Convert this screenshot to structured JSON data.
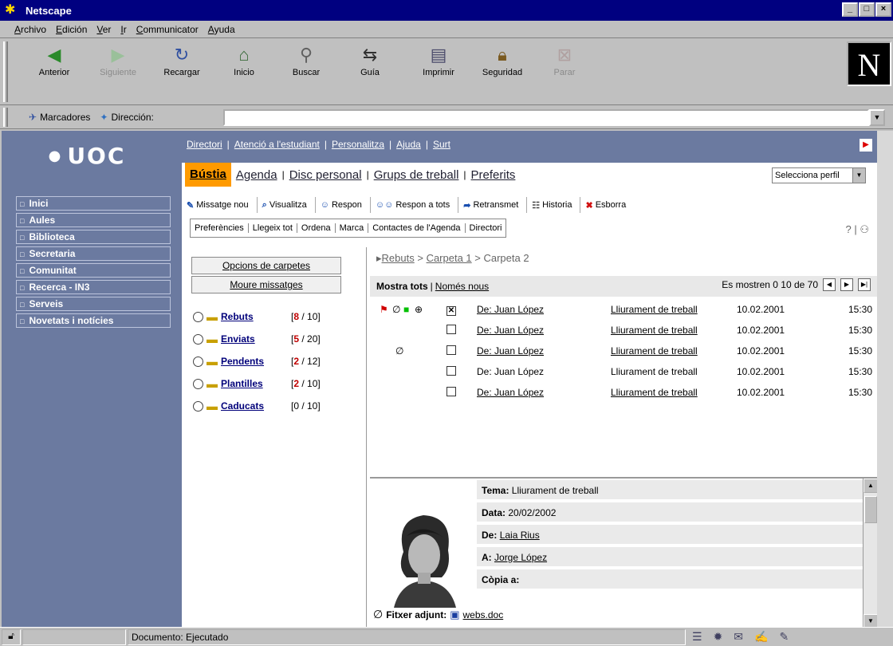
{
  "window": {
    "title": "Netscape"
  },
  "menu": [
    "Archivo",
    "Edición",
    "Ver",
    "Ir",
    "Communicator",
    "Ayuda"
  ],
  "toolbar": [
    {
      "label": "Anterior",
      "icon": "back-arrow-icon"
    },
    {
      "label": "Siguiente",
      "icon": "forward-arrow-icon",
      "disabled": true
    },
    {
      "label": "Recargar",
      "icon": "reload-icon"
    },
    {
      "label": "Inicio",
      "icon": "home-icon"
    },
    {
      "label": "Buscar",
      "icon": "search-icon"
    },
    {
      "label": "Guía",
      "icon": "guide-icon"
    },
    {
      "label": "Imprimir",
      "icon": "printer-icon"
    },
    {
      "label": "Seguridad",
      "icon": "lock-icon"
    },
    {
      "label": "Parar",
      "icon": "stop-icon",
      "disabled": true
    }
  ],
  "location": {
    "bookmarks": "Marcadores",
    "direccion": "Dirección:",
    "url": ""
  },
  "uoc": {
    "logo": "UOC",
    "toplinks": [
      "Directori",
      "Atenció a l'estudiant",
      "Personalitza",
      "Ajuda",
      "Surt"
    ],
    "tabs": {
      "active": "Bústia",
      "others": [
        "Agenda",
        "Disc personal",
        "Grups de treball",
        "Preferits"
      ]
    },
    "perfil": "Selecciona perfil"
  },
  "sidebar": [
    "Inici",
    "Aules",
    "Biblioteca",
    "Secretaria",
    "Comunitat",
    "Recerca - IN3",
    "Serveis",
    "Novetats i notícies"
  ],
  "actions": [
    "Missatge nou",
    "Visualitza",
    "Respon",
    "Respon a tots",
    "Retransmet",
    "Historia",
    "Esborra"
  ],
  "menu2": [
    "Preferències",
    "Llegeix tot",
    "Ordena",
    "Marca",
    "Contactes de l'Agenda",
    "Directori"
  ],
  "folders": {
    "opcions": "Opcions de carpetes",
    "moure": "Moure missatges",
    "list": [
      {
        "name": "Rebuts",
        "unread": "8",
        "total": "/ 10]",
        "open": "["
      },
      {
        "name": "Enviats",
        "unread": "5",
        "total": "/ 20]",
        "open": "["
      },
      {
        "name": "Pendents",
        "unread": "2",
        "total": "/ 12]",
        "open": "["
      },
      {
        "name": "Plantilles",
        "unread": "2",
        "total": "/ 10]",
        "open": "["
      },
      {
        "name": "Caducats",
        "unread": "",
        "total": "[0 / 10]",
        "open": ""
      }
    ]
  },
  "breadcrumb": {
    "a": "Rebuts",
    "b": "Carpeta 1",
    "c": "Carpeta 2"
  },
  "list": {
    "mostra_tots": "Mostra tots",
    "nomes_nous": "Només nous",
    "count": "Es mostren 0 10 de 70"
  },
  "messages": [
    {
      "from": "De: Juan López",
      "subject": "Lliurament de treball",
      "date": "10.02.2001",
      "time": "15:30"
    },
    {
      "from": "De: Juan López",
      "subject": "Lliurament de treball",
      "date": "10.02.2001",
      "time": "15:30"
    },
    {
      "from": "De: Juan López",
      "subject": "Lliurament de treball",
      "date": "10.02.2001",
      "time": "15:30"
    },
    {
      "from": "De: Juan López",
      "subject": "Lliurament de treball",
      "date": "10.02.2001",
      "time": "15:30"
    },
    {
      "from": "De: Juan López",
      "subject": "Lliurament de treball",
      "date": "10.02.2001",
      "time": "15:30"
    }
  ],
  "preview": {
    "tema_label": "Tema:",
    "tema": "Lliurament de treball",
    "data_label": "Data:",
    "data": "20/02/2002",
    "de_label": "De:",
    "de": "Laia Rius",
    "a_label": "A:",
    "a": "Jorge López",
    "copia_label": "Còpia a:",
    "attach_label": "Fitxer adjunt:",
    "attach_file": "webs.doc"
  },
  "status": {
    "text": "Documento: Ejecutado"
  }
}
